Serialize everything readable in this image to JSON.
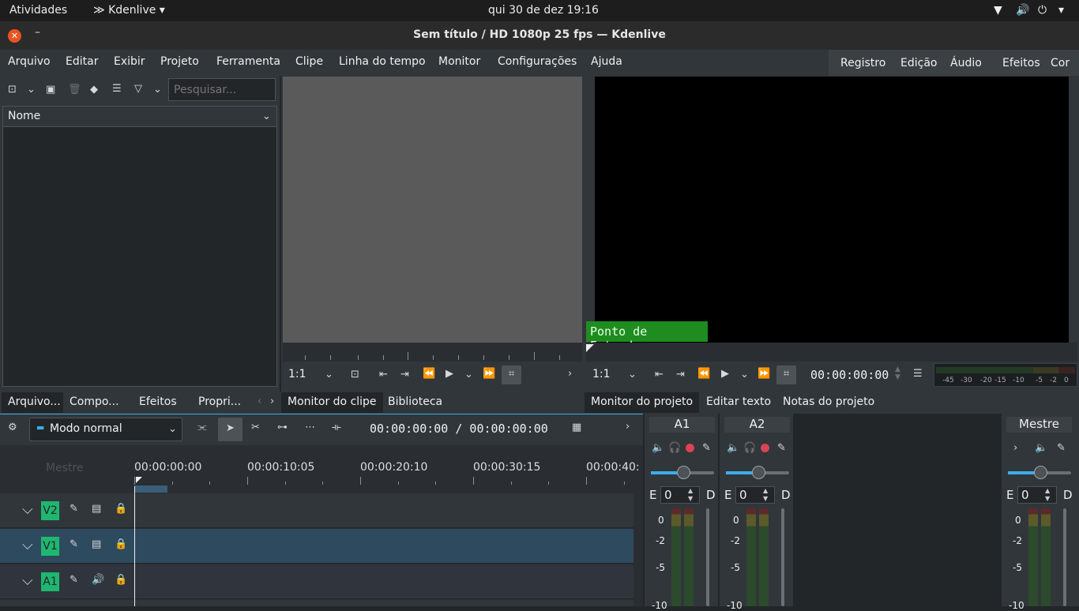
{
  "system_bar": {
    "activities": "Atividades",
    "app_name": "Kdenlive",
    "datetime": "qui 30 de dez  19:16"
  },
  "window": {
    "title": "Sem título / HD 1080p 25 fps — Kdenlive"
  },
  "menu": [
    "Arquivo",
    "Editar",
    "Exibir",
    "Projeto",
    "Ferramenta",
    "Clipe",
    "Linha do tempo",
    "Monitor",
    "Configurações",
    "Ajuda"
  ],
  "layouts": [
    "Registro",
    "Edição",
    "Áudio",
    "Efeitos",
    "Cor"
  ],
  "bin": {
    "search_placeholder": "Pesquisar...",
    "column": "Nome"
  },
  "left_tabs": [
    "Arquivo...",
    "Compo...",
    "Efeitos",
    "Propri..."
  ],
  "clip_monitor": {
    "zoom": "1:1",
    "tabs": [
      "Monitor do clipe",
      "Biblioteca"
    ]
  },
  "project_monitor": {
    "zoom": "1:1",
    "timecode": "00:00:00:00",
    "overlay": "Ponto de Entrada",
    "tabs": [
      "Monitor do projeto",
      "Editar texto",
      "Notas do projeto"
    ],
    "vu_labels": [
      "-45",
      "-30",
      "-20",
      "-15",
      "-10",
      "-5",
      "-2",
      "0"
    ]
  },
  "timeline_toolbar": {
    "mode": "Modo normal",
    "position": "00:00:00:00 / 00:00:00:00"
  },
  "timeline": {
    "master_label": "Mestre",
    "ruler": [
      "00:00:00:00",
      "00:00:10:05",
      "00:00:20:10",
      "00:00:30:15",
      "00:00:40:"
    ],
    "tracks": [
      {
        "name": "V2",
        "type": "video",
        "selected": false
      },
      {
        "name": "V1",
        "type": "video",
        "selected": true
      },
      {
        "name": "A1",
        "type": "audio",
        "selected": false
      }
    ]
  },
  "mixer": {
    "strips": [
      {
        "name": "A1",
        "left": "E",
        "value": "0",
        "right": "D"
      },
      {
        "name": "A2",
        "left": "E",
        "value": "0",
        "right": "D"
      },
      {
        "name": "Mestre",
        "left": "E",
        "value": "0",
        "right": "D"
      }
    ],
    "db_scale": [
      "0",
      "-2",
      "-5",
      "-10"
    ]
  },
  "colors": {
    "accent_green": "#1fb770",
    "record_red": "#da4453",
    "slider_blue": "#3daee9",
    "selected_track": "#2e4a5e"
  }
}
